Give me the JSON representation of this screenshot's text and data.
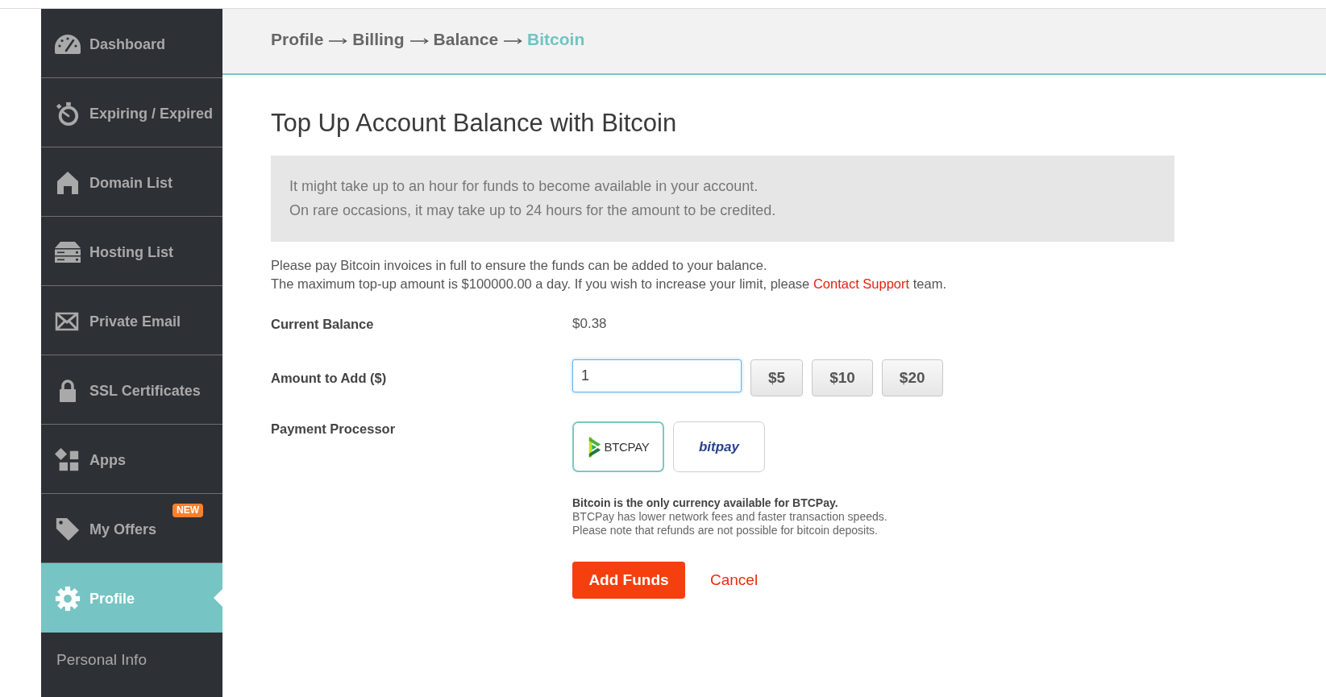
{
  "sidebar": {
    "items": [
      {
        "label": "Dashboard",
        "selected": false
      },
      {
        "label": "Expiring / Expired",
        "selected": false
      },
      {
        "label": "Domain List",
        "selected": false
      },
      {
        "label": "Hosting List",
        "selected": false
      },
      {
        "label": "Private Email",
        "selected": false
      },
      {
        "label": "SSL Certificates",
        "selected": false
      },
      {
        "label": "Apps",
        "selected": false
      },
      {
        "label": "My Offers",
        "selected": false,
        "badge": "NEW"
      },
      {
        "label": "Profile",
        "selected": true,
        "children": [
          {
            "label": "Personal Info",
            "selected": false
          }
        ]
      }
    ]
  },
  "breadcrumb": [
    {
      "label": "Profile",
      "current": false
    },
    {
      "label": "Billing",
      "current": false
    },
    {
      "label": "Balance",
      "current": false
    },
    {
      "label": "Bitcoin",
      "current": true
    }
  ],
  "page_title": "Top Up Account Balance with Bitcoin",
  "notice": [
    "It might take up to an hour for funds to become available in your account.",
    "On rare occasions, it may take up to 24 hours for the amount to be credited."
  ],
  "instructions": [
    {
      "text": "Please pay Bitcoin invoices in full to ensure the funds can be added to your balance."
    },
    {
      "text": "The maximum top-up amount is $100000.00 a day. If you wish to increase your limit, please",
      "link": "Contact Support",
      "after": "team."
    }
  ],
  "form": {
    "rows": [
      {
        "kind": "value",
        "label": "Current Balance",
        "value": "$0.38"
      },
      {
        "kind": "amount",
        "label": "Amount to Add ($)",
        "value": "1",
        "focused": true,
        "presets": [
          "$5",
          "$10",
          "$20"
        ]
      },
      {
        "kind": "processor",
        "label": "Payment Processor",
        "options": [
          {
            "kind": "btcpay",
            "name": "BTCPAY",
            "selected": true
          },
          {
            "kind": "bitpay",
            "name": "bitpay",
            "selected": false
          }
        ],
        "note": {
          "title": "Bitcoin is the only currency available for BTCPay.",
          "lines": [
            "BTCPay has lower network fees and faster transaction speeds.",
            "Please note that refunds are not possible for bitcoin deposits."
          ]
        }
      }
    ]
  },
  "actions": [
    {
      "kind": "primary",
      "label": "Add Funds"
    },
    {
      "kind": "link",
      "label": "Cancel"
    }
  ]
}
